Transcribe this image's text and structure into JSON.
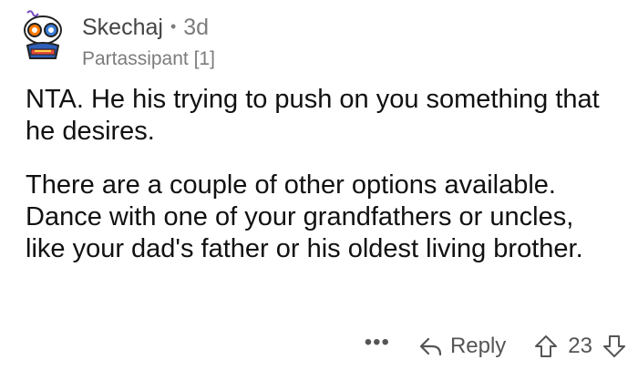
{
  "comment": {
    "author": "Skechaj",
    "separator": "•",
    "age": "3d",
    "flair": "Partassipant [1]",
    "paragraphs": [
      "NTA. He his trying to push on you something that he desires.",
      "There are a couple of other options available. Dance with one of your grandfathers or uncles, like your dad's father or his oldest living brother."
    ]
  },
  "actions": {
    "more_label": "•••",
    "reply_label": "Reply",
    "score": "23"
  },
  "icons": {
    "avatar": "snoo-avatar-icon",
    "reply": "reply-arrow-icon",
    "upvote": "upvote-arrow-icon",
    "downvote": "downvote-arrow-icon"
  },
  "colors": {
    "text": "#1a1a1b",
    "muted": "#7c7c7c",
    "icon": "#555555"
  }
}
